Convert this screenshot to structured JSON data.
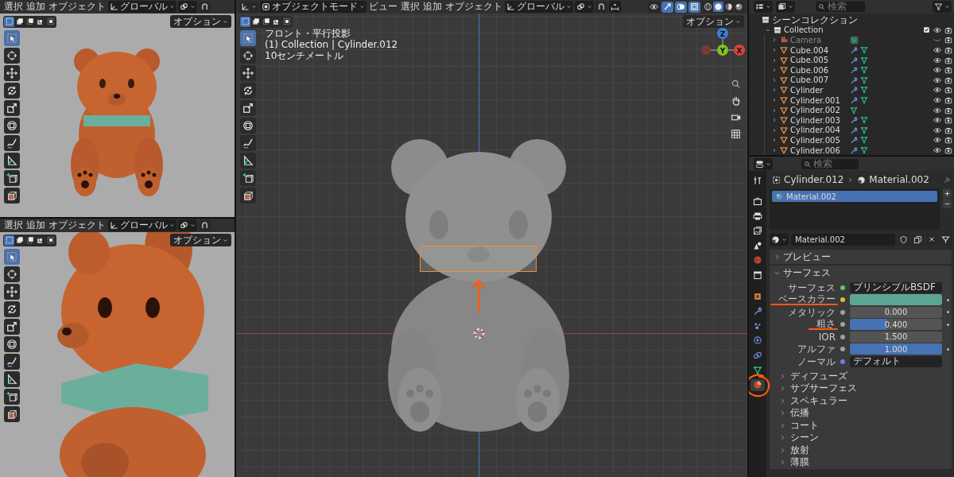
{
  "left_viewports": [
    {
      "kind": "full",
      "menus": [
        "選択",
        "追加",
        "オブジェクト"
      ],
      "orientation": "グローバル",
      "options": "オプション",
      "selection_modes": [
        {
          "selected": true
        },
        {
          "selected": false
        },
        {
          "selected": false
        },
        {
          "selected": false
        },
        {
          "selected": false
        }
      ],
      "tools": [
        {
          "kind": "select",
          "selected": true
        },
        {
          "kind": "cursor",
          "selected": false
        },
        {
          "kind": "move",
          "selected": false
        },
        {
          "kind": "rotate",
          "selected": false
        },
        {
          "kind": "scale",
          "selected": false
        },
        {
          "kind": "transform",
          "selected": false
        },
        {
          "kind": "annotate",
          "selected": false
        },
        {
          "kind": "measure",
          "selected": false
        },
        {
          "kind": "add_cube",
          "selected": false
        },
        {
          "kind": "cube_arrow",
          "selected": false
        }
      ]
    },
    {
      "kind": "closeup",
      "menus": [
        "選択",
        "追加",
        "オブジェクト"
      ],
      "orientation": "グローバル",
      "options": "オプション",
      "selection_modes": [
        {
          "selected": true
        },
        {
          "selected": false
        },
        {
          "selected": false
        },
        {
          "selected": false
        },
        {
          "selected": false
        }
      ],
      "tools": [
        {
          "kind": "select",
          "selected": true
        },
        {
          "kind": "cursor",
          "selected": false
        },
        {
          "kind": "move",
          "selected": false
        },
        {
          "kind": "rotate",
          "selected": false
        },
        {
          "kind": "scale",
          "selected": false
        },
        {
          "kind": "transform",
          "selected": false
        },
        {
          "kind": "annotate",
          "selected": false
        },
        {
          "kind": "measure",
          "selected": false
        },
        {
          "kind": "add_cube",
          "selected": false
        },
        {
          "kind": "cube_arrow",
          "selected": false
        }
      ]
    }
  ],
  "main_viewport": {
    "mode": "オブジェクトモード",
    "menus": [
      "ビュー",
      "選択",
      "追加",
      "オブジェクト"
    ],
    "orientation": "グローバル",
    "options": "オプション",
    "header_toggles": [
      {
        "kind": "gizmo",
        "on": true
      },
      {
        "kind": "overlay",
        "on": true
      },
      {
        "kind": "xray",
        "on": true
      }
    ],
    "shading_modes": [
      {
        "selected": false
      },
      {
        "selected": true
      },
      {
        "selected": false
      },
      {
        "selected": false
      }
    ],
    "selection_modes": [
      {
        "selected": true
      },
      {
        "selected": false
      },
      {
        "selected": false
      },
      {
        "selected": false
      },
      {
        "selected": false
      }
    ],
    "tools": [
      {
        "kind": "select",
        "selected": true
      },
      {
        "kind": "cursor",
        "selected": false
      },
      {
        "kind": "move",
        "selected": false
      },
      {
        "kind": "rotate",
        "selected": false
      },
      {
        "kind": "scale",
        "selected": false
      },
      {
        "kind": "transform",
        "selected": false
      },
      {
        "kind": "annotate",
        "selected": false
      },
      {
        "kind": "measure",
        "selected": false
      },
      {
        "kind": "add_cube",
        "selected": false
      },
      {
        "kind": "cube_arrow",
        "selected": false
      }
    ],
    "overlay_text": [
      "フロント・平行投影",
      "(1) Collection | Cylinder.012",
      "10センチメートル"
    ],
    "gizmo_axes": [
      {
        "label": "Z",
        "color": "#3d7ed8"
      },
      {
        "label": "Y",
        "color": "#80c020"
      },
      {
        "label": "X",
        "color": "#d8443a"
      }
    ]
  },
  "outliner": {
    "search_placeholder": "検索",
    "scene_collection": "シーンコレクション",
    "collection": {
      "name": "Collection",
      "expanded": true,
      "checked": true,
      "children": [
        {
          "name": "Camera",
          "kind": "camera",
          "modifier": false,
          "visible": false
        },
        {
          "name": "Cube.004",
          "kind": "mesh",
          "modifier": true,
          "visible": true
        },
        {
          "name": "Cube.005",
          "kind": "mesh",
          "modifier": true,
          "visible": true
        },
        {
          "name": "Cube.006",
          "kind": "mesh",
          "modifier": true,
          "visible": true
        },
        {
          "name": "Cube.007",
          "kind": "mesh",
          "modifier": true,
          "visible": true
        },
        {
          "name": "Cylinder",
          "kind": "mesh",
          "modifier": true,
          "visible": true
        },
        {
          "name": "Cylinder.001",
          "kind": "mesh",
          "modifier": true,
          "visible": true
        },
        {
          "name": "Cylinder.002",
          "kind": "mesh",
          "modifier": false,
          "visible": true
        },
        {
          "name": "Cylinder.003",
          "kind": "mesh",
          "modifier": true,
          "visible": true
        },
        {
          "name": "Cylinder.004",
          "kind": "mesh",
          "modifier": true,
          "visible": true
        },
        {
          "name": "Cylinder.005",
          "kind": "mesh",
          "modifier": true,
          "visible": true
        },
        {
          "name": "Cylinder.006",
          "kind": "mesh",
          "modifier": true,
          "visible": true
        }
      ]
    }
  },
  "properties": {
    "search_placeholder": "検索",
    "tabs": [
      {
        "kind": "tool",
        "selected": false,
        "circled": false
      },
      {
        "kind": "render",
        "selected": false,
        "circled": false
      },
      {
        "kind": "output",
        "selected": false,
        "circled": false
      },
      {
        "kind": "view_layer",
        "selected": false,
        "circled": false
      },
      {
        "kind": "scene",
        "selected": false,
        "circled": false
      },
      {
        "kind": "world",
        "selected": false,
        "circled": false
      },
      {
        "kind": "collection",
        "selected": false,
        "circled": false
      },
      {
        "kind": "object",
        "selected": false,
        "circled": false
      },
      {
        "kind": "modifier",
        "selected": false,
        "circled": false
      },
      {
        "kind": "particles",
        "selected": false,
        "circled": false
      },
      {
        "kind": "physics",
        "selected": false,
        "circled": false
      },
      {
        "kind": "constraints",
        "selected": false,
        "circled": false
      },
      {
        "kind": "data",
        "selected": false,
        "circled": false
      },
      {
        "kind": "material",
        "selected": true,
        "circled": true
      }
    ],
    "breadcrumb": [
      "Cylinder.012",
      "Material.002"
    ],
    "material_slots": [
      {
        "name": "Material.002",
        "selected": true
      }
    ],
    "material_name": "Material.002",
    "panels": [
      {
        "title": "プレビュー",
        "expanded": false
      },
      {
        "title": "サーフェス",
        "expanded": true,
        "fields": [
          {
            "label": "サーフェス",
            "kind": "shader",
            "value": "プリンシプルBSDF",
            "keyframe": false,
            "underlined": false
          },
          {
            "label": "ベースカラー",
            "kind": "color",
            "color": "#5da593",
            "keyframe": true,
            "underlined": true
          },
          {
            "label": "メタリック",
            "kind": "slider",
            "level": 0,
            "value": "0.000",
            "keyframe": true,
            "underlined": false
          },
          {
            "label": "粗さ",
            "kind": "slider",
            "level": 0.4,
            "value": "0.400",
            "keyframe": true,
            "underlined": true
          },
          {
            "label": "IOR",
            "kind": "number",
            "value": "1.500",
            "keyframe": false,
            "underlined": false
          },
          {
            "label": "アルファ",
            "kind": "slider",
            "level": 1,
            "value": "1.000",
            "keyframe": true,
            "underlined": false
          },
          {
            "label": "ノーマル",
            "kind": "vector",
            "value": "デフォルト",
            "keyframe": false,
            "underlined": false
          }
        ],
        "subpanels": [
          {
            "title": "ディフューズ",
            "expanded": false
          },
          {
            "title": "サブサーフェス",
            "expanded": false
          },
          {
            "title": "スペキュラー",
            "expanded": false
          },
          {
            "title": "伝播",
            "expanded": false
          },
          {
            "title": "コート",
            "expanded": false
          },
          {
            "title": "シーン",
            "expanded": false
          },
          {
            "title": "放射",
            "expanded": false
          },
          {
            "title": "薄膜",
            "expanded": false
          }
        ]
      }
    ]
  }
}
